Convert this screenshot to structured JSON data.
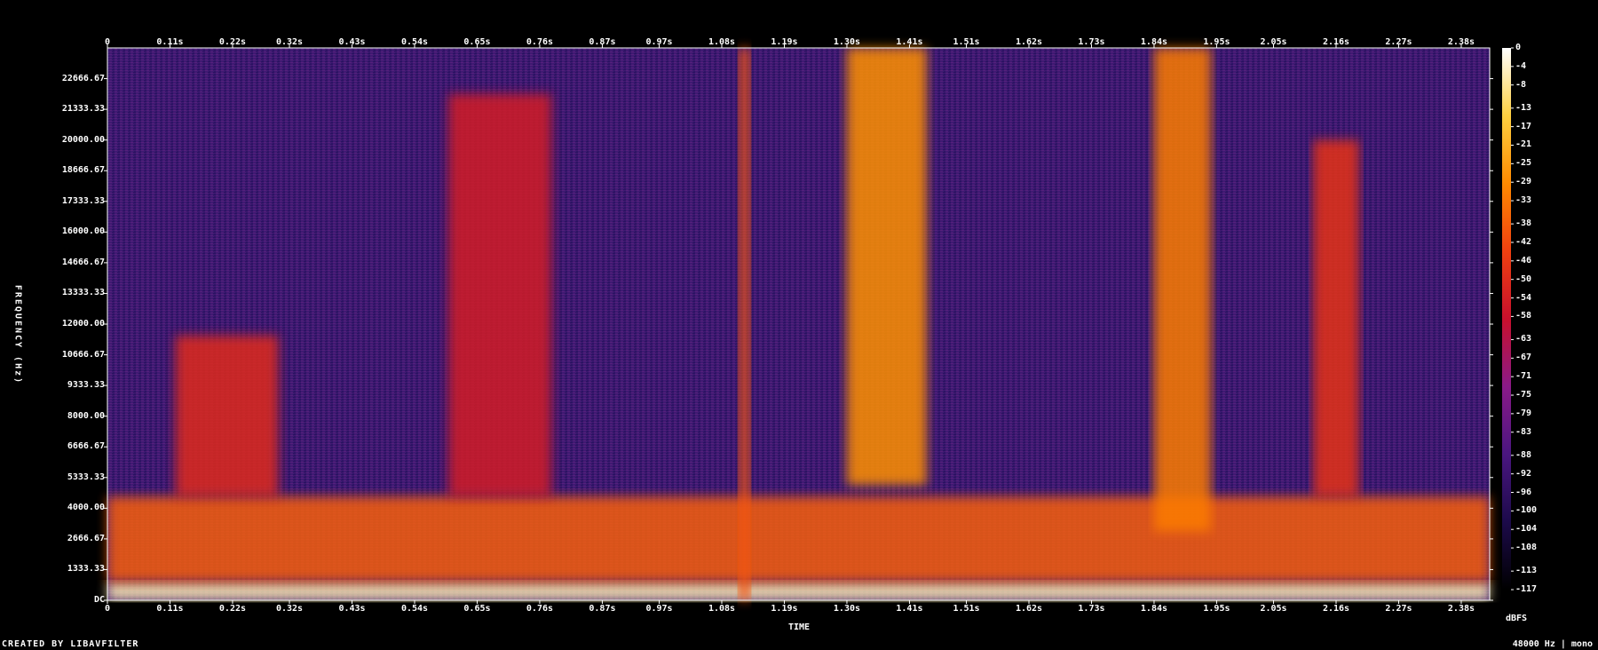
{
  "chart_data": {
    "type": "heatmap",
    "title": "",
    "xlabel": "TIME",
    "ylabel": "FREQUENCY (Hz)",
    "x_ticks": [
      "0",
      "0.11s",
      "0.22s",
      "0.32s",
      "0.43s",
      "0.54s",
      "0.65s",
      "0.76s",
      "0.87s",
      "0.97s",
      "1.08s",
      "1.19s",
      "1.30s",
      "1.41s",
      "1.51s",
      "1.62s",
      "1.73s",
      "1.84s",
      "1.95s",
      "2.05s",
      "2.16s",
      "2.27s",
      "2.38s"
    ],
    "x_tick_values": [
      0,
      0.11,
      0.22,
      0.32,
      0.43,
      0.54,
      0.65,
      0.76,
      0.87,
      0.97,
      1.08,
      1.19,
      1.3,
      1.41,
      1.51,
      1.62,
      1.73,
      1.84,
      1.95,
      2.05,
      2.16,
      2.27,
      2.38
    ],
    "xlim": [
      0,
      2.43
    ],
    "y_ticks": [
      "DC",
      "1333.33",
      "2666.67",
      "4000.00",
      "5333.33",
      "6666.67",
      "8000.00",
      "9333.33",
      "10666.67",
      "12000.00",
      "13333.33",
      "14666.67",
      "16000.00",
      "17333.33",
      "18666.67",
      "20000.00",
      "21333.33",
      "22666.67"
    ],
    "y_tick_values": [
      0,
      1333.33,
      2666.67,
      4000,
      5333.33,
      6666.67,
      8000,
      9333.33,
      10666.67,
      12000,
      13333.33,
      14666.67,
      16000,
      17333.33,
      18666.67,
      20000,
      21333.33,
      22666.67
    ],
    "ylim": [
      0,
      24000
    ],
    "colorbar": {
      "unit": "dBFS",
      "range": [
        -117,
        0
      ],
      "labels": [
        "0",
        "-4",
        "-8",
        "-13",
        "-17",
        "-21",
        "-25",
        "-29",
        "-33",
        "-38",
        "-42",
        "-46",
        "-50",
        "-54",
        "-58",
        "-63",
        "-67",
        "-71",
        "-75",
        "-79",
        "-83",
        "-88",
        "-92",
        "-96",
        "-100",
        "-104",
        "-108",
        "-113",
        "-117"
      ],
      "label_values": [
        0,
        -4,
        -8,
        -13,
        -17,
        -21,
        -25,
        -29,
        -33,
        -38,
        -42,
        -46,
        -50,
        -54,
        -58,
        -63,
        -67,
        -71,
        -75,
        -79,
        -83,
        -88,
        -92,
        -96,
        -100,
        -104,
        -108,
        -113,
        -117
      ],
      "colors": [
        "#000000",
        "#1c0a4a",
        "#4a1680",
        "#8a1a88",
        "#c8102c",
        "#f04010",
        "#ff8a00",
        "#ffd040",
        "#ffffff"
      ]
    },
    "energy_regions": [
      {
        "t": [
          0.0,
          2.43
        ],
        "f": [
          0,
          800
        ],
        "level": -6
      },
      {
        "t": [
          0.0,
          2.43
        ],
        "f": [
          800,
          4500
        ],
        "level": -38
      },
      {
        "t": [
          0.12,
          0.3
        ],
        "f": [
          4500,
          11500
        ],
        "level": -50
      },
      {
        "t": [
          0.6,
          0.78
        ],
        "f": [
          4500,
          22000
        ],
        "level": -55
      },
      {
        "t": [
          1.11,
          1.13
        ],
        "f": [
          0,
          24000
        ],
        "level": -40
      },
      {
        "t": [
          1.3,
          1.44
        ],
        "f": [
          5000,
          24000
        ],
        "level": -28
      },
      {
        "t": [
          1.84,
          1.94
        ],
        "f": [
          3000,
          24000
        ],
        "level": -32
      },
      {
        "t": [
          2.12,
          2.2
        ],
        "f": [
          4500,
          20000
        ],
        "level": -48
      }
    ]
  },
  "footer": {
    "left": "CREATED BY LIBAVFILTER",
    "right": "48000 Hz | mono"
  }
}
